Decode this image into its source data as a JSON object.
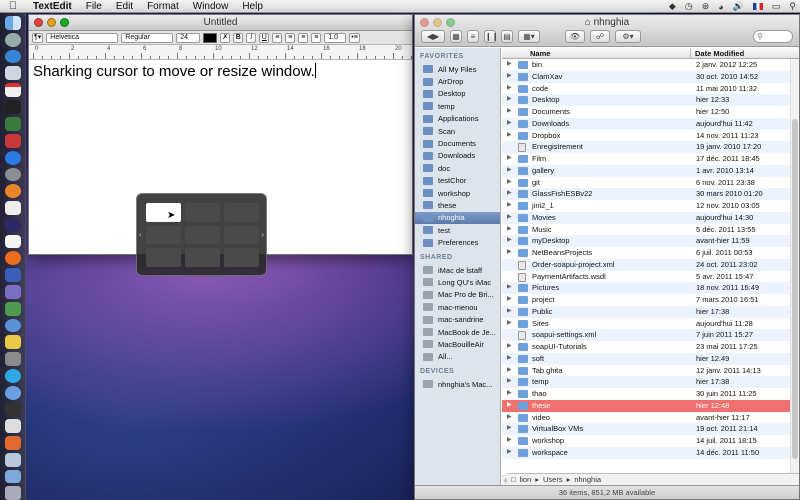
{
  "menubar": {
    "app_name": "TextEdit",
    "items": [
      "File",
      "Edit",
      "Format",
      "Window",
      "Help"
    ]
  },
  "textedit": {
    "title": "Untitled",
    "font_family": "Helvetica",
    "font_style": "Regular",
    "font_size": "24",
    "spacing": "1.0",
    "ruler_numbers": [
      "0",
      "2",
      "4",
      "6",
      "8",
      "10",
      "12",
      "14",
      "16",
      "18",
      "20"
    ],
    "body_text": "Sharking cursor to move or resize window."
  },
  "finder": {
    "title": "nhnghia",
    "sidebar": {
      "favorites_header": "FAVORITES",
      "favorites": [
        "All My Files",
        "AirDrop",
        "Desktop",
        "temp",
        "Applications",
        "Scan",
        "Documents",
        "Downloads",
        "doc",
        "testChor",
        "workshop",
        "these",
        "nhnghia",
        "test",
        "Preferences"
      ],
      "selected": "nhnghia",
      "shared_header": "SHARED",
      "shared": [
        "iMac de lstaff",
        "Long QU's iMac",
        "Mac Pro de Bri...",
        "mac-menou",
        "mac-sandrine",
        "MacBook de Je...",
        "MacBouilleAir",
        "All..."
      ],
      "devices_header": "DEVICES",
      "devices": [
        "nhnghia's Mac..."
      ]
    },
    "columns": {
      "name": "Name",
      "date": "Date Modified"
    },
    "files": [
      {
        "name": "bin",
        "date": "2 janv. 2012 12:25",
        "type": "folder"
      },
      {
        "name": "ClamXav",
        "date": "30 oct. 2010 14:52",
        "type": "folder"
      },
      {
        "name": "code",
        "date": "11 mai 2010 11:32",
        "type": "folder"
      },
      {
        "name": "Desktop",
        "date": "hier 12:33",
        "type": "folder"
      },
      {
        "name": "Documents",
        "date": "hier 12:50",
        "type": "folder"
      },
      {
        "name": "Downloads",
        "date": "aujourd'hui 11:42",
        "type": "folder"
      },
      {
        "name": "Dropbox",
        "date": "14 nov. 2011 11:23",
        "type": "folder"
      },
      {
        "name": "Enregistrement",
        "date": "19 janv. 2010 17:20",
        "type": "file"
      },
      {
        "name": "Film",
        "date": "17 déc. 2011 18:45",
        "type": "folder"
      },
      {
        "name": "gallery",
        "date": "1 avr. 2010 13:14",
        "type": "folder"
      },
      {
        "name": "git",
        "date": "6 nov. 2011 23:38",
        "type": "folder"
      },
      {
        "name": "GlassFishESBv22",
        "date": "30 mars 2010 01:20",
        "type": "folder"
      },
      {
        "name": "jini2_1",
        "date": "12 nov. 2010 03:05",
        "type": "folder"
      },
      {
        "name": "Movies",
        "date": "aujourd'hui 14:30",
        "type": "folder"
      },
      {
        "name": "Music",
        "date": "5 déc. 2011 13:55",
        "type": "folder"
      },
      {
        "name": "myDesktop",
        "date": "avant-hier 11:59",
        "type": "folder"
      },
      {
        "name": "NetBeansProjects",
        "date": "6 juil. 2011 00:53",
        "type": "folder"
      },
      {
        "name": "Order-soapui-project.xml",
        "date": "24 oct. 2011 23:02",
        "type": "file"
      },
      {
        "name": "PaymentArtifacts.wsdl",
        "date": "5 avr. 2011 15:47",
        "type": "file"
      },
      {
        "name": "Pictures",
        "date": "18 nov. 2011 16:49",
        "type": "folder"
      },
      {
        "name": "project",
        "date": "7 mars 2010 16:51",
        "type": "folder"
      },
      {
        "name": "Public",
        "date": "hier 17:38",
        "type": "folder"
      },
      {
        "name": "Sites",
        "date": "aujourd'hui 11:28",
        "type": "folder"
      },
      {
        "name": "soapui-settings.xml",
        "date": "7 juin 2011 15:27",
        "type": "file"
      },
      {
        "name": "soapUI-Tutorials",
        "date": "23 mai 2011 17:25",
        "type": "folder"
      },
      {
        "name": "soft",
        "date": "hier 12:49",
        "type": "folder"
      },
      {
        "name": "Tab ghita",
        "date": "12 janv. 2011 14:13",
        "type": "folder"
      },
      {
        "name": "temp",
        "date": "hier 17:38",
        "type": "folder"
      },
      {
        "name": "thao",
        "date": "30 juin 2011 11:25",
        "type": "folder"
      },
      {
        "name": "these",
        "date": "hier 12:48",
        "type": "folder",
        "selected": true
      },
      {
        "name": "video",
        "date": "avant-hier 11:17",
        "type": "folder"
      },
      {
        "name": "VirtualBox VMs",
        "date": "19 oct. 2011 21:14",
        "type": "folder"
      },
      {
        "name": "workshop",
        "date": "14 juil. 2011 18:15",
        "type": "folder"
      },
      {
        "name": "workspace",
        "date": "14 déc. 2011 11:50",
        "type": "folder"
      }
    ],
    "path": [
      "lion",
      "Users",
      "nhnghia"
    ],
    "status": "36 items, 851,2 MB available"
  },
  "colors": {
    "folder": "#6ea1dc",
    "file": "#e8e8e8",
    "selected_row": "#f0706d",
    "sidebar_bg": "#dde4ec"
  }
}
